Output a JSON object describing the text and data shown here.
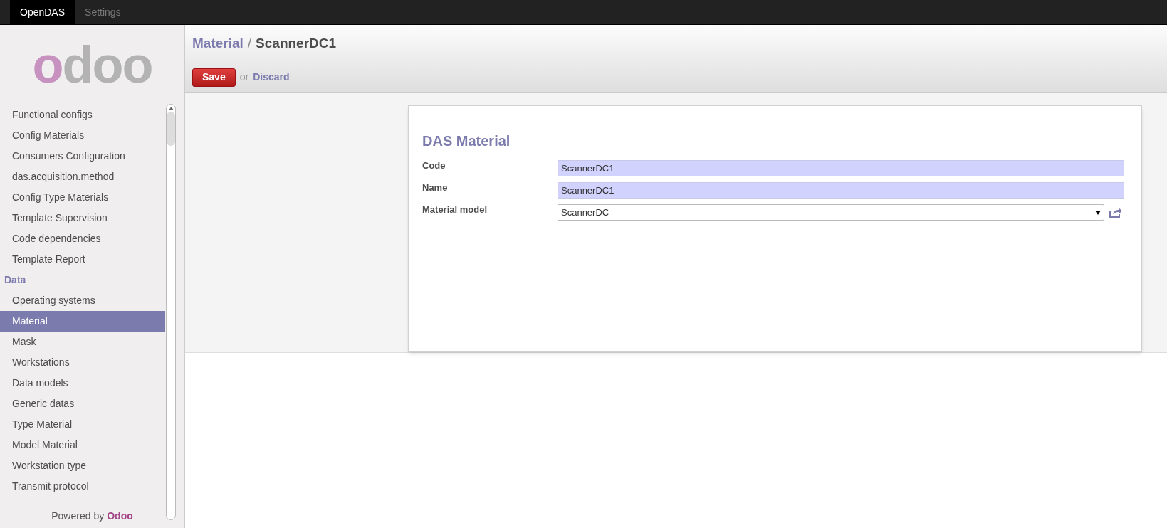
{
  "top_menu": [
    {
      "label": "OpenDAS",
      "selected": true
    },
    {
      "label": "Settings",
      "selected": false
    }
  ],
  "logo": {
    "text": "odoo"
  },
  "sidebar": {
    "items": [
      {
        "kind": "item",
        "label": "Functional configs",
        "selected": false
      },
      {
        "kind": "item",
        "label": "Config Materials",
        "selected": false
      },
      {
        "kind": "item",
        "label": "Consumers Configuration",
        "selected": false
      },
      {
        "kind": "item",
        "label": "das.acquisition.method",
        "selected": false
      },
      {
        "kind": "item",
        "label": "Config Type Materials",
        "selected": false
      },
      {
        "kind": "item",
        "label": "Template Supervision",
        "selected": false
      },
      {
        "kind": "item",
        "label": "Code dependencies",
        "selected": false
      },
      {
        "kind": "item",
        "label": "Template Report",
        "selected": false
      },
      {
        "kind": "header",
        "label": "Data"
      },
      {
        "kind": "item",
        "label": "Operating systems",
        "selected": false
      },
      {
        "kind": "item",
        "label": "Material",
        "selected": true
      },
      {
        "kind": "item",
        "label": "Mask",
        "selected": false
      },
      {
        "kind": "item",
        "label": "Workstations",
        "selected": false
      },
      {
        "kind": "item",
        "label": "Data models",
        "selected": false
      },
      {
        "kind": "item",
        "label": "Generic datas",
        "selected": false
      },
      {
        "kind": "item",
        "label": "Type Material",
        "selected": false
      },
      {
        "kind": "item",
        "label": "Model Material",
        "selected": false
      },
      {
        "kind": "item",
        "label": "Workstation type",
        "selected": false
      },
      {
        "kind": "item",
        "label": "Transmit protocol",
        "selected": false
      }
    ],
    "footer": {
      "text": "Powered by",
      "brand": "Odoo"
    }
  },
  "breadcrumb": {
    "parent": "Material",
    "separator": "/",
    "current": "ScannerDC1"
  },
  "actions": {
    "save": "Save",
    "or": "or",
    "discard": "Discard"
  },
  "form": {
    "title": "DAS Material",
    "fields": [
      {
        "kind": "text",
        "label": "Code",
        "value": "ScannerDC1",
        "required": true
      },
      {
        "kind": "text",
        "label": "Name",
        "value": "ScannerDC1",
        "required": true
      },
      {
        "kind": "select",
        "label": "Material model",
        "value": "ScannerDC",
        "required": false
      }
    ]
  }
}
